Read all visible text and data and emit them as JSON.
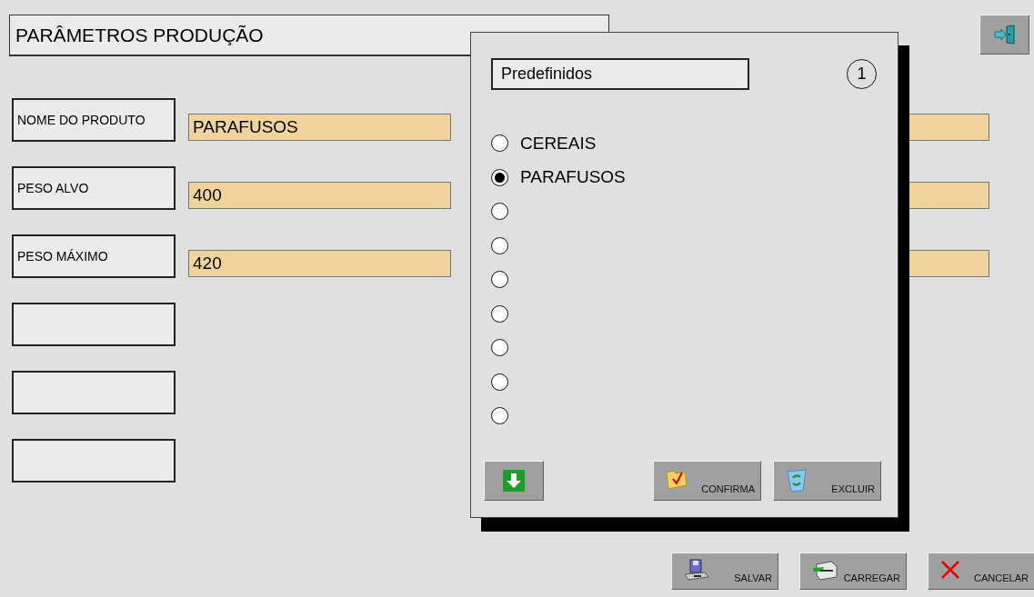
{
  "title": "PARÂMETROS PRODUÇÃO",
  "rows": [
    {
      "kind": "field",
      "label": "NOME DO PRODUTO",
      "value": "PARAFUSOS"
    },
    {
      "kind": "field",
      "label": "PESO ALVO",
      "value": "400"
    },
    {
      "kind": "field",
      "label": "PESO MÁXIMO",
      "value": "420"
    },
    {
      "kind": "blank"
    },
    {
      "kind": "blank"
    },
    {
      "kind": "blank"
    }
  ],
  "dialog": {
    "title": "Predefinidos",
    "page": "1",
    "options": [
      {
        "label": "CEREAIS",
        "selected": false
      },
      {
        "label": "PARAFUSOS",
        "selected": true
      },
      {
        "selected": false
      },
      {
        "selected": false
      },
      {
        "selected": false
      },
      {
        "selected": false
      },
      {
        "selected": false
      },
      {
        "selected": false
      },
      {
        "selected": false
      }
    ],
    "buttons": [
      {
        "kind": "confirm",
        "label": "CONFIRMA"
      },
      {
        "kind": "delete",
        "label": "EXCLUIR"
      }
    ]
  },
  "buttons": [
    {
      "kind": "save",
      "label": "SALVAR"
    },
    {
      "kind": "load",
      "label": "CARREGAR"
    },
    {
      "kind": "cancel",
      "label": "CANCELAR"
    }
  ]
}
